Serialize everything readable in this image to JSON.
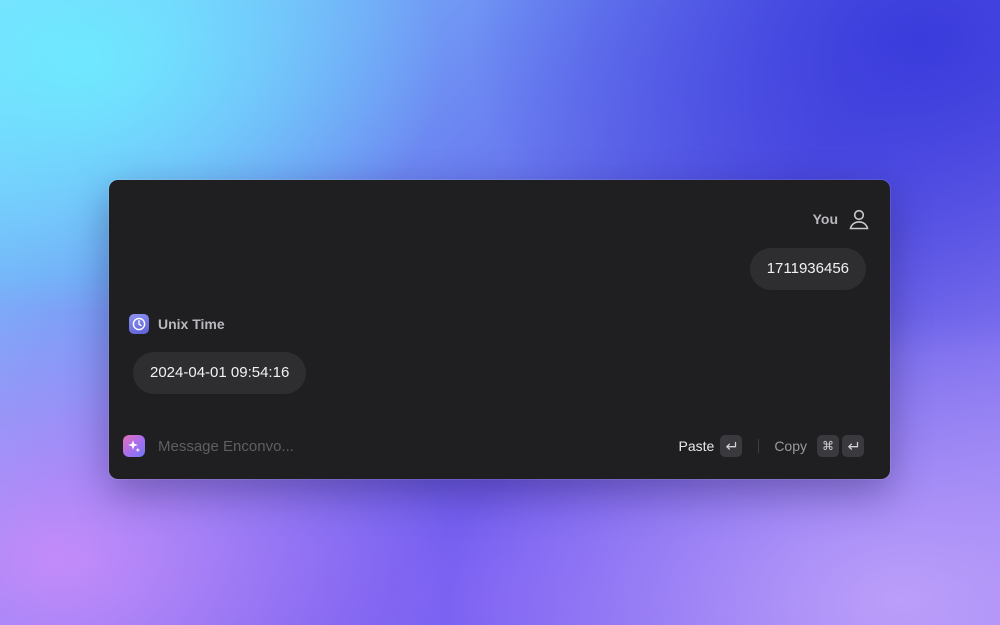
{
  "conversation": {
    "user_label": "You",
    "user_message": "1711936456",
    "app_name": "Unix Time",
    "result_message": "2024-04-01 09:54:16"
  },
  "footer": {
    "input_placeholder": "Message Enconvo...",
    "paste_label": "Paste",
    "copy_label": "Copy",
    "command_key": "⌘"
  },
  "icons": {
    "user": "person-outline-icon",
    "app": "clock-icon",
    "ai": "sparkle-icon",
    "enter": "return-key-icon"
  }
}
